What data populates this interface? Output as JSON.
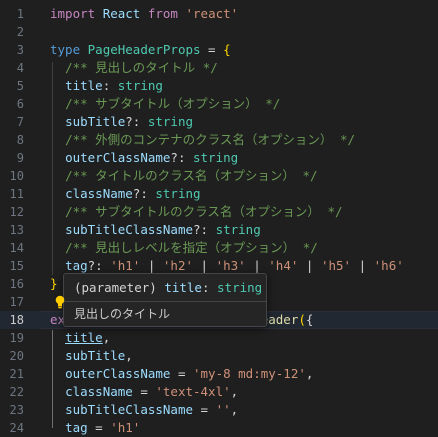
{
  "tooltip": {
    "kind": "(parameter)",
    "name": "title",
    "colon": ":",
    "type": "string",
    "doc": "見出しのタイトル"
  },
  "lines": [
    {
      "n": "1",
      "parts": [
        [
          "k2",
          "import"
        ],
        [
          "op",
          " "
        ],
        [
          "id",
          "React"
        ],
        [
          "op",
          " "
        ],
        [
          "k2",
          "from"
        ],
        [
          "op",
          " "
        ],
        [
          "str",
          "'react'"
        ]
      ]
    },
    {
      "n": "2",
      "parts": []
    },
    {
      "n": "3",
      "parts": [
        [
          "k",
          "type"
        ],
        [
          "op",
          " "
        ],
        [
          "ty",
          "PageHeaderProps"
        ],
        [
          "op",
          " = "
        ],
        [
          "br",
          "{"
        ]
      ]
    },
    {
      "n": "4",
      "parts": [
        [
          "op",
          "  "
        ],
        [
          "cm",
          "/** 見出しのタイトル */"
        ]
      ]
    },
    {
      "n": "5",
      "parts": [
        [
          "op",
          "  "
        ],
        [
          "id",
          "title"
        ],
        [
          "op",
          ": "
        ],
        [
          "ty",
          "string"
        ]
      ]
    },
    {
      "n": "6",
      "parts": [
        [
          "op",
          "  "
        ],
        [
          "cm",
          "/** サブタイトル（オプション） */"
        ]
      ]
    },
    {
      "n": "7",
      "parts": [
        [
          "op",
          "  "
        ],
        [
          "id",
          "subTitle"
        ],
        [
          "op",
          "?: "
        ],
        [
          "ty",
          "string"
        ]
      ]
    },
    {
      "n": "8",
      "parts": [
        [
          "op",
          "  "
        ],
        [
          "cm",
          "/** 外側のコンテナのクラス名（オプション） */"
        ]
      ]
    },
    {
      "n": "9",
      "parts": [
        [
          "op",
          "  "
        ],
        [
          "id",
          "outerClassName"
        ],
        [
          "op",
          "?: "
        ],
        [
          "ty",
          "string"
        ]
      ]
    },
    {
      "n": "10",
      "parts": [
        [
          "op",
          "  "
        ],
        [
          "cm",
          "/** タイトルのクラス名（オプション） */"
        ]
      ]
    },
    {
      "n": "11",
      "parts": [
        [
          "op",
          "  "
        ],
        [
          "id",
          "className"
        ],
        [
          "op",
          "?: "
        ],
        [
          "ty",
          "string"
        ]
      ]
    },
    {
      "n": "12",
      "parts": [
        [
          "op",
          "  "
        ],
        [
          "cm",
          "/** サブタイトルのクラス名（オプション） */"
        ]
      ]
    },
    {
      "n": "13",
      "parts": [
        [
          "op",
          "  "
        ],
        [
          "id",
          "subTitleClassName"
        ],
        [
          "op",
          "?: "
        ],
        [
          "ty",
          "string"
        ]
      ]
    },
    {
      "n": "14",
      "parts": [
        [
          "op",
          "  "
        ],
        [
          "cm",
          "/** 見出しレベルを指定（オプション） */"
        ]
      ]
    },
    {
      "n": "15",
      "parts": [
        [
          "op",
          "  "
        ],
        [
          "id",
          "tag"
        ],
        [
          "op",
          "?: "
        ],
        [
          "str",
          "'h1'"
        ],
        [
          "op",
          " | "
        ],
        [
          "str",
          "'h2'"
        ],
        [
          "op",
          " | "
        ],
        [
          "str",
          "'h3'"
        ],
        [
          "op",
          " | "
        ],
        [
          "str",
          "'h4'"
        ],
        [
          "op",
          " | "
        ],
        [
          "str",
          "'h5'"
        ],
        [
          "op",
          " | "
        ],
        [
          "str",
          "'h6'"
        ]
      ]
    },
    {
      "n": "16",
      "parts": [
        [
          "br",
          "}"
        ]
      ]
    },
    {
      "n": "17",
      "parts": []
    },
    {
      "n": "18",
      "parts": [
        [
          "k2",
          "ex"
        ],
        [
          "op",
          "                          "
        ],
        [
          "fn",
          "eader"
        ],
        [
          "br",
          "("
        ],
        [
          "op",
          "{"
        ]
      ]
    },
    {
      "n": "19",
      "parts": [
        [
          "op",
          "  "
        ],
        [
          "id ul",
          "title"
        ],
        [
          "op",
          ","
        ]
      ]
    },
    {
      "n": "20",
      "parts": [
        [
          "op",
          "  "
        ],
        [
          "id",
          "subTitle"
        ],
        [
          "op",
          ","
        ]
      ]
    },
    {
      "n": "21",
      "parts": [
        [
          "op",
          "  "
        ],
        [
          "id",
          "outerClassName"
        ],
        [
          "op",
          " = "
        ],
        [
          "str",
          "'my-8 md:my-12'"
        ],
        [
          "op",
          ","
        ]
      ]
    },
    {
      "n": "22",
      "parts": [
        [
          "op",
          "  "
        ],
        [
          "id",
          "className"
        ],
        [
          "op",
          " = "
        ],
        [
          "str",
          "'text-4xl'"
        ],
        [
          "op",
          ","
        ]
      ]
    },
    {
      "n": "23",
      "parts": [
        [
          "op",
          "  "
        ],
        [
          "id",
          "subTitleClassName"
        ],
        [
          "op",
          " = "
        ],
        [
          "str",
          "''"
        ],
        [
          "op",
          ","
        ]
      ]
    },
    {
      "n": "24",
      "parts": [
        [
          "op",
          "  "
        ],
        [
          "id",
          "tag"
        ],
        [
          "op",
          " = "
        ],
        [
          "str",
          "'h1'"
        ]
      ]
    }
  ]
}
